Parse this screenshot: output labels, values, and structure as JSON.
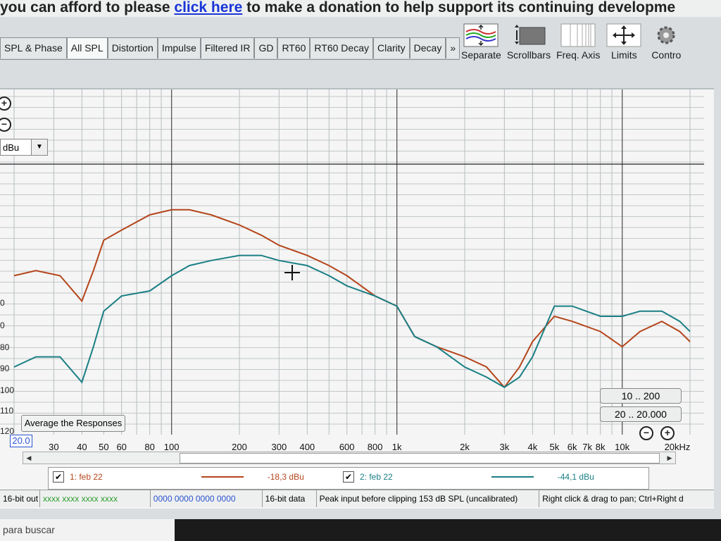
{
  "banner": {
    "pre": "you can afford to please ",
    "link": "click here",
    "post": " to make a donation to help support its continuing developme"
  },
  "tabs": [
    "SPL & Phase",
    "All SPL",
    "Distortion",
    "Impulse",
    "Filtered IR",
    "GD",
    "RT60",
    "RT60 Decay",
    "Clarity",
    "Decay",
    "»"
  ],
  "active_tab": "All SPL",
  "toolbar": [
    {
      "label": "Separate",
      "icon": "separate-icon"
    },
    {
      "label": "Scrollbars",
      "icon": "scrollbars-icon"
    },
    {
      "label": "Freq. Axis",
      "icon": "freq-axis-icon"
    },
    {
      "label": "Limits",
      "icon": "limits-icon"
    },
    {
      "label": "Contro",
      "icon": "controls-icon"
    }
  ],
  "graph": {
    "unit_select": "dBu",
    "y_ticks": [
      "0",
      "0",
      "80",
      "90",
      "100",
      "110",
      "120"
    ],
    "x_start": "20.0",
    "x_ticks": [
      "30",
      "40",
      "50",
      "60",
      "80",
      "100",
      "200",
      "300",
      "400",
      "600",
      "800",
      "1k",
      "2k",
      "3k",
      "4k",
      "5k",
      "6k",
      "7k",
      "8k",
      "10k",
      "20kHz"
    ],
    "average_button": "Average the Responses",
    "range_buttons": [
      "10 .. 200",
      "20 .. 20.000"
    ]
  },
  "chart_data": {
    "type": "line",
    "x_scale": "log",
    "xlim": [
      20,
      20000
    ],
    "series": [
      {
        "name": "1: feb 22",
        "color": "#b5451b",
        "x": [
          20,
          25,
          32,
          40,
          45,
          50,
          60,
          80,
          100,
          120,
          150,
          200,
          250,
          300,
          400,
          500,
          600,
          800,
          1000,
          1200,
          1500,
          2000,
          2500,
          3000,
          3500,
          4000,
          5000,
          6000,
          8000,
          10000,
          12000,
          15000,
          18000,
          20000
        ],
        "y": [
          -22,
          -21,
          -22,
          -27,
          -21,
          -15,
          -13,
          -10,
          -9,
          -9,
          -10,
          -12,
          -14,
          -16,
          -18,
          -20,
          -22,
          -26,
          -28,
          -34,
          -36,
          -38,
          -40,
          -44,
          -40,
          -35,
          -30,
          -31,
          -33,
          -36,
          -33,
          -31,
          -33,
          -35
        ]
      },
      {
        "name": "2: feb 22",
        "color": "#1a7f85",
        "x": [
          20,
          25,
          32,
          40,
          45,
          50,
          60,
          80,
          100,
          120,
          150,
          200,
          250,
          300,
          400,
          500,
          600,
          800,
          1000,
          1200,
          1500,
          2000,
          2500,
          3000,
          3500,
          4000,
          5000,
          6000,
          8000,
          10000,
          12000,
          15000,
          18000,
          20000
        ],
        "y": [
          -40,
          -38,
          -38,
          -43,
          -36,
          -29,
          -26,
          -25,
          -22,
          -20,
          -19,
          -18,
          -18,
          -19,
          -20,
          -22,
          -24,
          -26,
          -28,
          -34,
          -36,
          -40,
          -42,
          -44,
          -42,
          -38,
          -28,
          -28,
          -30,
          -30,
          -29,
          -29,
          -31,
          -33
        ]
      }
    ]
  },
  "legend": [
    {
      "name": "1: feb 22",
      "value": "-18,3 dBu",
      "color": "#b5451b"
    },
    {
      "name": "2: feb 22",
      "value": "-44,1 dBu",
      "color": "#1a7f85"
    }
  ],
  "status": {
    "out": "16-bit out",
    "meter1": "xxxx xxxx  xxxx xxxx",
    "meter2": "0000 0000  0000 0000",
    "data": "16-bit data",
    "peak": "Peak input before clipping 153 dB SPL (uncalibrated)",
    "hint": "Right click & drag to pan; Ctrl+Right d"
  },
  "taskbar": {
    "search": "para buscar"
  }
}
